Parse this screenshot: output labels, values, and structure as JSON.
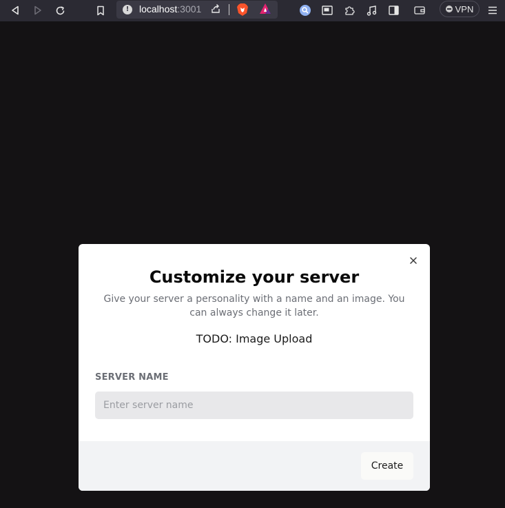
{
  "browser": {
    "url_host": "localhost",
    "url_port": ":3001",
    "vpn_label": "VPN",
    "icons": [
      "back-icon",
      "forward-icon",
      "reload-icon",
      "bookmark-icon",
      "site-info-icon",
      "share-icon",
      "brave-shields-icon",
      "brave-rewards-icon",
      "leo-icon",
      "picture-in-picture-icon",
      "extensions-icon",
      "media-icon",
      "sidebar-icon",
      "wallet-icon",
      "menu-icon"
    ]
  },
  "modal": {
    "title": "Customize your server",
    "description": "Give your server a personality with a name and an image. You can always change it later.",
    "image_upload_text": "TODO: Image Upload",
    "field_label": "SERVER NAME",
    "input_placeholder": "Enter server name",
    "input_value": "",
    "create_label": "Create"
  },
  "colors": {
    "page_background": "#141214",
    "toolbar_background": "#2b2a33",
    "modal_background": "#ffffff",
    "footer_background": "#f2f3f5",
    "input_background": "#e8e8ea"
  }
}
